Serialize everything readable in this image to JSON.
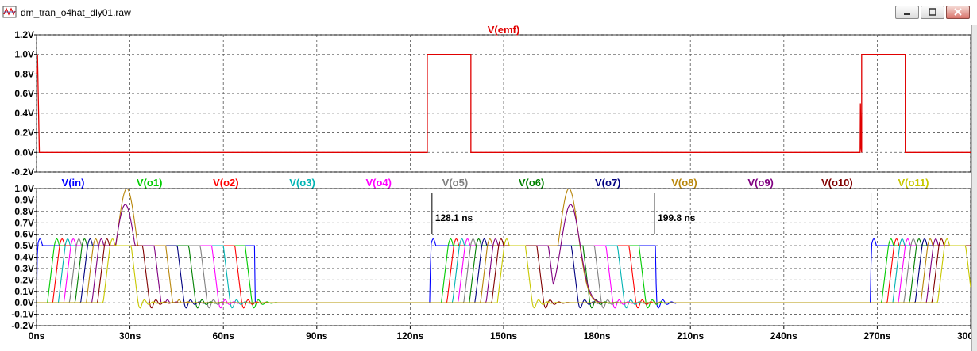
{
  "window": {
    "title": "dm_tran_o4hat_dly01.raw",
    "icon": "waveform-viewer-icon",
    "buttons": [
      "minimize",
      "restore",
      "close"
    ]
  },
  "chart_data": [
    {
      "type": "line",
      "title": "V(emf)",
      "ylim": [
        -0.2,
        1.2
      ],
      "yticks": [
        -0.2,
        0.0,
        0.2,
        0.4,
        0.6,
        0.8,
        1.0,
        1.2
      ],
      "ytick_labels": [
        "-0.2V",
        "0.0V",
        "0.2V",
        "0.4V",
        "0.6V",
        "0.8V",
        "1.0V",
        "1.2V"
      ],
      "xlim": [
        0,
        300
      ],
      "grid": true,
      "series": [
        {
          "name": "V(emf)",
          "color": "#e00000",
          "x": [
            0,
            0.3,
            0.6,
            0.9,
            1.2,
            125.5,
            125.5,
            139.5,
            139.5,
            264.5,
            264.6,
            264.8,
            265,
            265,
            279,
            279,
            300
          ],
          "y": [
            0.8,
            1.0,
            0.5,
            0.0,
            0.0,
            0.0,
            1.0,
            1.0,
            0.0,
            0.0,
            0.5,
            0.05,
            0.0,
            1.0,
            1.0,
            0.0,
            0.0
          ]
        }
      ]
    },
    {
      "type": "line",
      "ylim": [
        -0.2,
        1.0
      ],
      "yticks": [
        -0.2,
        -0.1,
        0.0,
        0.1,
        0.2,
        0.3,
        0.4,
        0.5,
        0.6,
        0.7,
        0.8,
        0.9,
        1.0
      ],
      "ytick_labels": [
        "-0.2V",
        "-0.1V",
        "0.0V",
        "0.1V",
        "0.2V",
        "0.3V",
        "0.4V",
        "0.5V",
        "0.6V",
        "0.7V",
        "0.8V",
        "0.9V",
        "1.0V"
      ],
      "xlim": [
        0,
        300
      ],
      "xticks": [
        0,
        30,
        60,
        90,
        120,
        150,
        180,
        210,
        240,
        270,
        300
      ],
      "xtick_labels": [
        "0ns",
        "30ns",
        "60ns",
        "90ns",
        "120ns",
        "150ns",
        "180ns",
        "210ns",
        "240ns",
        "270ns",
        "300ns"
      ],
      "grid": true,
      "series": [
        {
          "name": "V(in)",
          "color": "#0000ff",
          "pulse_starts": [
            0,
            126.3,
            267.8
          ],
          "pulse_width": 72.5
        },
        {
          "name": "V(o1)",
          "color": "#00cc00",
          "pulse_starts": [
            3.5,
            130.0,
            271.4
          ],
          "pulse_width": 63.5
        },
        {
          "name": "V(o2)",
          "color": "#ff0000",
          "pulse_starts": [
            5.2,
            131.8,
            273.2
          ],
          "pulse_width": 58.5
        },
        {
          "name": "V(o3)",
          "color": "#00b3b3",
          "pulse_starts": [
            7.0,
            133.6,
            275.0
          ],
          "pulse_width": 53.0
        },
        {
          "name": "V(o4)",
          "color": "#ff00ff",
          "pulse_starts": [
            8.8,
            135.4,
            276.8
          ],
          "pulse_width": 47.5
        },
        {
          "name": "V(o5)",
          "color": "#808080",
          "pulse_starts": [
            10.6,
            137.2,
            278.6
          ],
          "pulse_width": 42.0
        },
        {
          "name": "V(o6)",
          "color": "#008000",
          "pulse_starts": [
            12.4,
            139.0,
            280.4
          ],
          "pulse_width": 36.5
        },
        {
          "name": "V(o7)",
          "color": "#000080",
          "pulse_starts": [
            14.2,
            140.8,
            282.2
          ],
          "pulse_width": 31.0
        },
        {
          "name": "V(o8)",
          "color": "#b8860b",
          "pulse_starts": [
            16.0,
            142.6,
            284.0
          ],
          "pulse_width": 25.5
        },
        {
          "name": "V(o9)",
          "color": "#800080",
          "pulse_starts": [
            17.8,
            144.4,
            285.8
          ],
          "pulse_width": 20.0
        },
        {
          "name": "V(o10)",
          "color": "#800000",
          "pulse_starts": [
            19.6,
            146.2,
            287.6
          ],
          "pulse_width": 14.5
        },
        {
          "name": "V(o11)",
          "color": "#c8c800",
          "pulse_starts": [
            21.4,
            148.0,
            289.4
          ],
          "pulse_width": 9.0
        }
      ],
      "hump_peaks": [
        {
          "x": 29.0,
          "y": 1.0,
          "series": "V(o8)"
        },
        {
          "x": 28.5,
          "y": 0.86,
          "series": "V(o9)"
        },
        {
          "x": 171.0,
          "y": 1.0,
          "series": "V(o8)"
        },
        {
          "x": 171.5,
          "y": 0.86,
          "series": "V(o9)"
        }
      ],
      "cursors": [
        {
          "x": 127.0,
          "label": "128.1 ns"
        },
        {
          "x": 198.5,
          "label": "199.8 ns"
        },
        {
          "x": 268.0,
          "label": ""
        }
      ]
    }
  ]
}
